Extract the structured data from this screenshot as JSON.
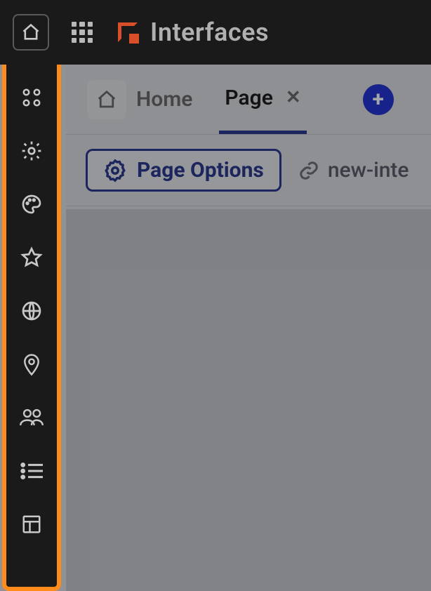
{
  "header": {
    "title": "Interfaces"
  },
  "sidebar": {
    "items": [
      {
        "name": "apps-icon"
      },
      {
        "name": "settings-gear-icon"
      },
      {
        "name": "palette-icon"
      },
      {
        "name": "star-icon"
      },
      {
        "name": "globe-icon"
      },
      {
        "name": "location-pin-icon"
      },
      {
        "name": "users-icon"
      },
      {
        "name": "list-icon"
      },
      {
        "name": "layout-icon"
      }
    ]
  },
  "tabs": {
    "home_label": "Home",
    "page_label": "Page",
    "close_glyph": "✕",
    "add_glyph": "+"
  },
  "toolbar": {
    "page_options_label": "Page Options",
    "url_fragment": "new-inte"
  }
}
